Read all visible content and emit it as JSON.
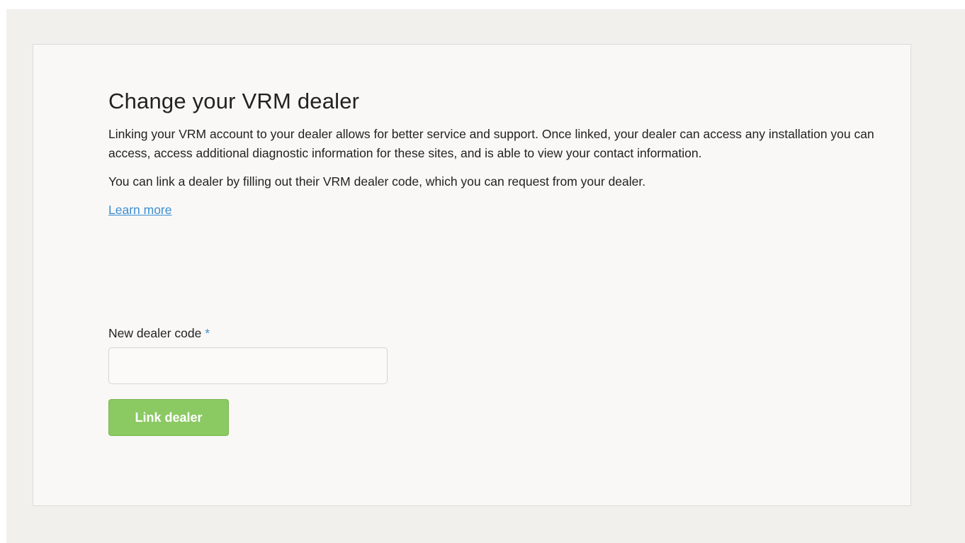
{
  "dealer_form": {
    "title": "Change your VRM dealer",
    "intro": "Linking your VRM account to your dealer allows for better service and support. Once linked, your dealer can access any installation you can access, access additional diagnostic information for these sites, and is able to view your contact information.",
    "instruction": "You can link a dealer by filling out their VRM dealer code, which you can request from your dealer.",
    "learn_more_label": "Learn more",
    "code_field": {
      "label": "New dealer code",
      "required_marker": "*",
      "value": "",
      "placeholder": ""
    },
    "submit_label": "Link dealer"
  },
  "colors": {
    "page_background": "#f1f0ed",
    "card_background": "#f9f8f6",
    "link": "#3d8fd1",
    "button": "#8bc963",
    "text": "#222222"
  }
}
